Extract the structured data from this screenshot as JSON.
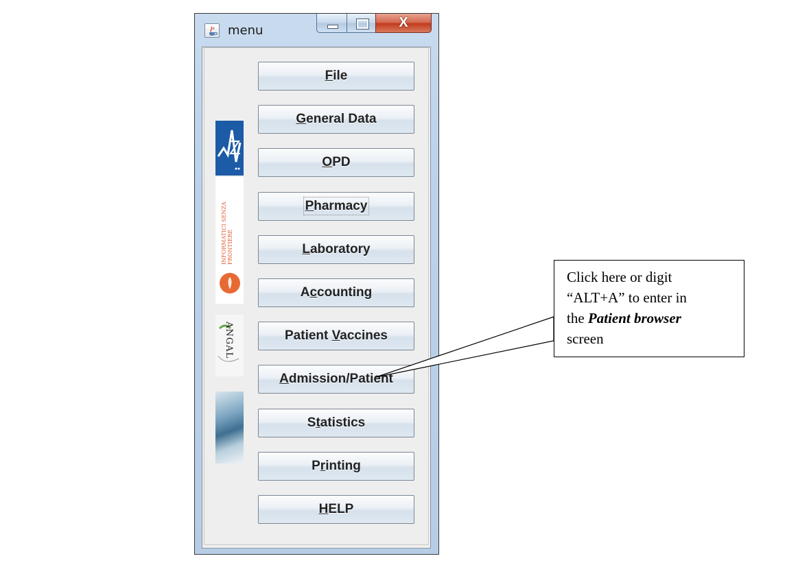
{
  "window": {
    "title": "menu",
    "close_glyph": "X"
  },
  "sidebar_logos": {
    "isf_text": "INFORMATICI SENZA FRONTIERE",
    "angal_text": "ANGAL"
  },
  "menu_buttons": [
    {
      "name": "file",
      "mnemonic_prefix": "",
      "mnemonic": "F",
      "suffix": "ile"
    },
    {
      "name": "general-data",
      "mnemonic_prefix": "",
      "mnemonic": "G",
      "suffix": "eneral Data"
    },
    {
      "name": "opd",
      "mnemonic_prefix": "",
      "mnemonic": "O",
      "suffix": "PD"
    },
    {
      "name": "pharmacy",
      "mnemonic_prefix": "",
      "mnemonic": "P",
      "suffix": "harmacy"
    },
    {
      "name": "laboratory",
      "mnemonic_prefix": "",
      "mnemonic": "L",
      "suffix": "aboratory"
    },
    {
      "name": "accounting",
      "mnemonic_prefix": "A",
      "mnemonic": "c",
      "suffix": "counting"
    },
    {
      "name": "patient-vaccines",
      "mnemonic_prefix": "Patient ",
      "mnemonic": "V",
      "suffix": "accines"
    },
    {
      "name": "admission-patient",
      "mnemonic_prefix": "",
      "mnemonic": "A",
      "suffix": "dmission/Patient"
    },
    {
      "name": "statistics",
      "mnemonic_prefix": "S",
      "mnemonic": "t",
      "suffix": "atistics"
    },
    {
      "name": "printing",
      "mnemonic_prefix": "P",
      "mnemonic": "r",
      "suffix": "inting"
    },
    {
      "name": "help",
      "mnemonic_prefix": "",
      "mnemonic": "H",
      "suffix": "ELP"
    }
  ],
  "callout": {
    "line1": "Click here or digit",
    "line2": "“ALT+A” to enter in",
    "line3_prefix": "the ",
    "line3_emphasis": "Patient browser",
    "line4": "screen"
  }
}
